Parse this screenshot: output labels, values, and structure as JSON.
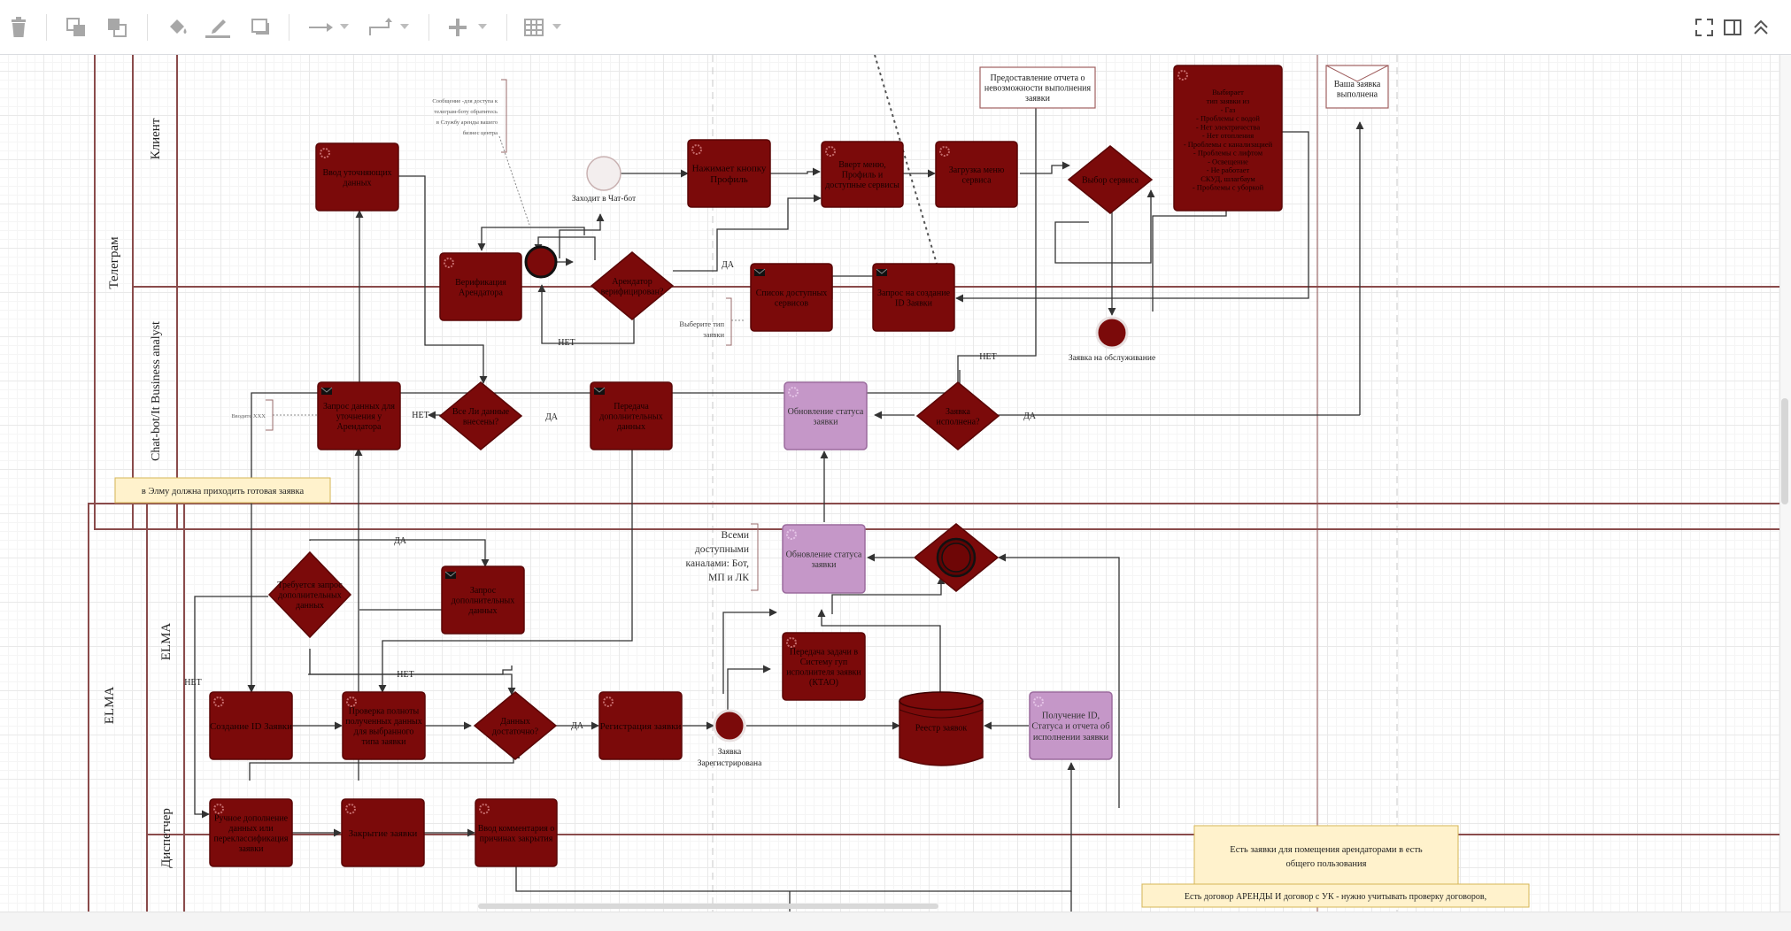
{
  "colors": {
    "node": "#7b0a0a",
    "node_border": "#5a0606",
    "status_node": "#c597c8",
    "lane_border": "#8a4b4b",
    "note": "#fff2cc",
    "note_border": "#d6b656"
  },
  "toolbar": {
    "items": [
      {
        "name": "delete-button",
        "icon": "trash-icon"
      },
      {
        "name": "to-front-button",
        "icon": "to-front-icon"
      },
      {
        "name": "to-back-button",
        "icon": "to-back-icon"
      },
      {
        "name": "fill-color-button",
        "icon": "fill-bucket-icon"
      },
      {
        "name": "line-color-button",
        "icon": "pencil-line-icon"
      },
      {
        "name": "shadow-button",
        "icon": "shadow-icon"
      },
      {
        "name": "connection-button",
        "icon": "arrow-right-icon"
      },
      {
        "name": "waypoints-button",
        "icon": "waypoints-icon"
      },
      {
        "name": "insert-button",
        "icon": "plus-icon"
      },
      {
        "name": "table-button",
        "icon": "table-icon"
      },
      {
        "name": "fullscreen-button",
        "icon": "fullscreen-icon"
      },
      {
        "name": "format-panel-button",
        "icon": "panel-icon"
      },
      {
        "name": "collapse-button",
        "icon": "double-chevron-up-icon"
      }
    ]
  },
  "pools": [
    {
      "id": "pool-telegram",
      "label": "Телеграм"
    },
    {
      "id": "pool-elma",
      "label": "ELMA"
    }
  ],
  "lanes": [
    {
      "id": "lane-client",
      "label": "Клиент"
    },
    {
      "id": "lane-chatbot",
      "label": "Chat-bot/It Business analyst"
    },
    {
      "id": "lane-elma",
      "label": "ELMA"
    },
    {
      "id": "lane-dispatcher",
      "label": "Диспетчер"
    }
  ],
  "nodes": {
    "n1": [
      "Ввод уточняющих",
      "данных"
    ],
    "n2": [
      "Нажимает кнопку",
      "Профиль"
    ],
    "n3": [
      "Вверт меню,",
      "Профиль и",
      "доступные сервисы"
    ],
    "n4": [
      "Загрузка меню",
      "сервиса"
    ],
    "n5": [
      "Выбор сервиса"
    ],
    "n6": [
      "Выбирает",
      "тип заявки из",
      "- Газ",
      "- Проблемы с водой",
      "- Нет электричества",
      "- Нет отопления",
      "- Проблемы с канализацией",
      "- Проблемы с лифтом",
      "- Освещение",
      "- Не работает",
      "СКУД, шлагбаум",
      "- Проблемы с уборкой"
    ],
    "n7": [
      "Предоставление отчета о",
      "невозможности выполнения",
      "заявки"
    ],
    "n8": [
      "Ваша заявка",
      "выполнена"
    ],
    "n9": [
      "Верификация",
      "Арендатора"
    ],
    "n10": [
      "Арендатор",
      "верифицирован?"
    ],
    "n11": [
      "Список доступных",
      "сервисов"
    ],
    "n12": [
      "Запрос на создание",
      "ID Заявки"
    ],
    "n13": [
      "Запрос данных для",
      "уточнения у",
      "Арендатора"
    ],
    "n14": [
      "Все Ли данные",
      "внесены?"
    ],
    "n15": [
      "Передача",
      "дополнительных",
      "данных"
    ],
    "n16": [
      "Обновление статуса",
      "заявки"
    ],
    "n17": [
      "Заявка",
      "исполнена?"
    ],
    "n18": [
      "Обновление статуса",
      "заявки"
    ],
    "n19": [
      "Запрос",
      "дополнительных",
      "данных"
    ],
    "n20": [
      "Требуется запрос",
      "дополнительных",
      "данных"
    ],
    "n21": [
      "Передача задачи в",
      "Систему гуп",
      "исполнителя заявки",
      "(КТАО)"
    ],
    "n22": [
      "Создание ID Заявки"
    ],
    "n23": [
      "Проверка полноты",
      "полученных данных",
      "для выбранного",
      "типа заявки"
    ],
    "n24": [
      "Данных",
      "достаточно?"
    ],
    "n25": [
      "Регистрация заявки"
    ],
    "n26": [
      "Реестр заявок"
    ],
    "n27": [
      "Получение ID,",
      "Статуса и отчета об",
      "исполнении заявки"
    ],
    "n28": [
      "Ручное дополнение",
      "данных или",
      "переклассификация",
      "заявки"
    ],
    "n29": [
      "Закрытие заявки"
    ],
    "n30": [
      "Ввод комментария о",
      "причинах закрытия"
    ]
  },
  "events": {
    "start_label": "Заходит в Чат-бот",
    "end1_label": "Заявка на обслуживание",
    "end2_label": [
      "Заявка",
      "Зарегистрирована"
    ]
  },
  "edge_labels": {
    "yes": "ДА",
    "no": "НЕТ"
  },
  "annotations": {
    "a1": [
      "Сообщение -для доступа к",
      "телеграм-боту обратитесь",
      "в Службу аренды вашего",
      "бизнес центра"
    ],
    "a2": [
      "Выберите тип",
      "заявки"
    ],
    "a3": [
      "Вводите ХХХ"
    ],
    "a4": [
      "Всеми",
      "доступными",
      "каналами: Бот,",
      "МП и ЛК"
    ]
  },
  "notes": {
    "note1": "в Элму должна приходить готовая заявка",
    "note2": [
      "Есть заявки для помещения арендаторами  в есть",
      "общего пользования"
    ],
    "note3": "Есть договор АРЕНДЫ И договор с УК - нужно учитывать проверку договоров,"
  }
}
